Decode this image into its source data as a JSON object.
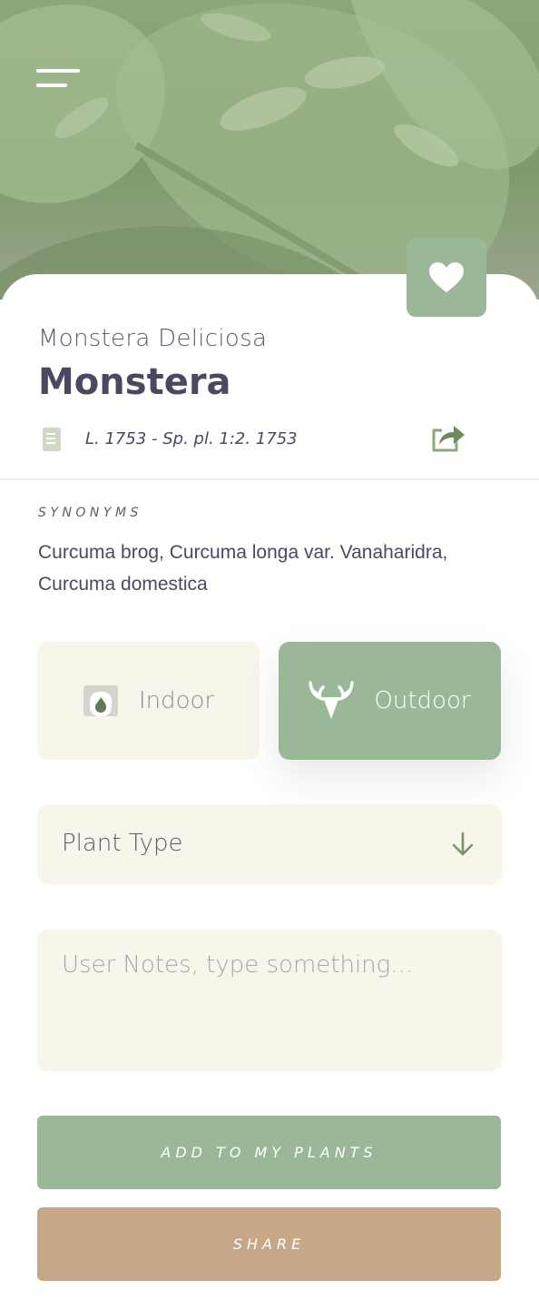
{
  "header": {
    "menu_icon": "hamburger-menu-icon",
    "favorite_icon": "heart-icon"
  },
  "plant": {
    "scientific_name": "Monstera Deliciosa",
    "common_name": "Monstera",
    "reference": "L. 1753 - Sp. pl. 1:2. 1753",
    "reference_icon": "book-icon",
    "share_icon": "share-arrow-icon"
  },
  "synonyms": {
    "label": "SYNONYMS",
    "text": "Curcuma brog, Curcuma longa var. Vanaharidra, Curcuma domestica"
  },
  "location": {
    "options": [
      {
        "label": "Indoor",
        "icon": "fireplace-icon",
        "selected": false
      },
      {
        "label": "Outdoor",
        "icon": "antlers-icon",
        "selected": true
      }
    ]
  },
  "form": {
    "plant_type_label": "Plant Type",
    "plant_type_icon": "arrow-down-icon",
    "notes_placeholder": "User Notes, type something..."
  },
  "actions": {
    "add_label": "ADD TO MY PLANTS",
    "share_label": "SHARE"
  },
  "colors": {
    "accent_green": "#9ab898",
    "accent_tan": "#c6a889",
    "field_bg": "#f8f5eb",
    "text_dark": "#4a4962"
  }
}
